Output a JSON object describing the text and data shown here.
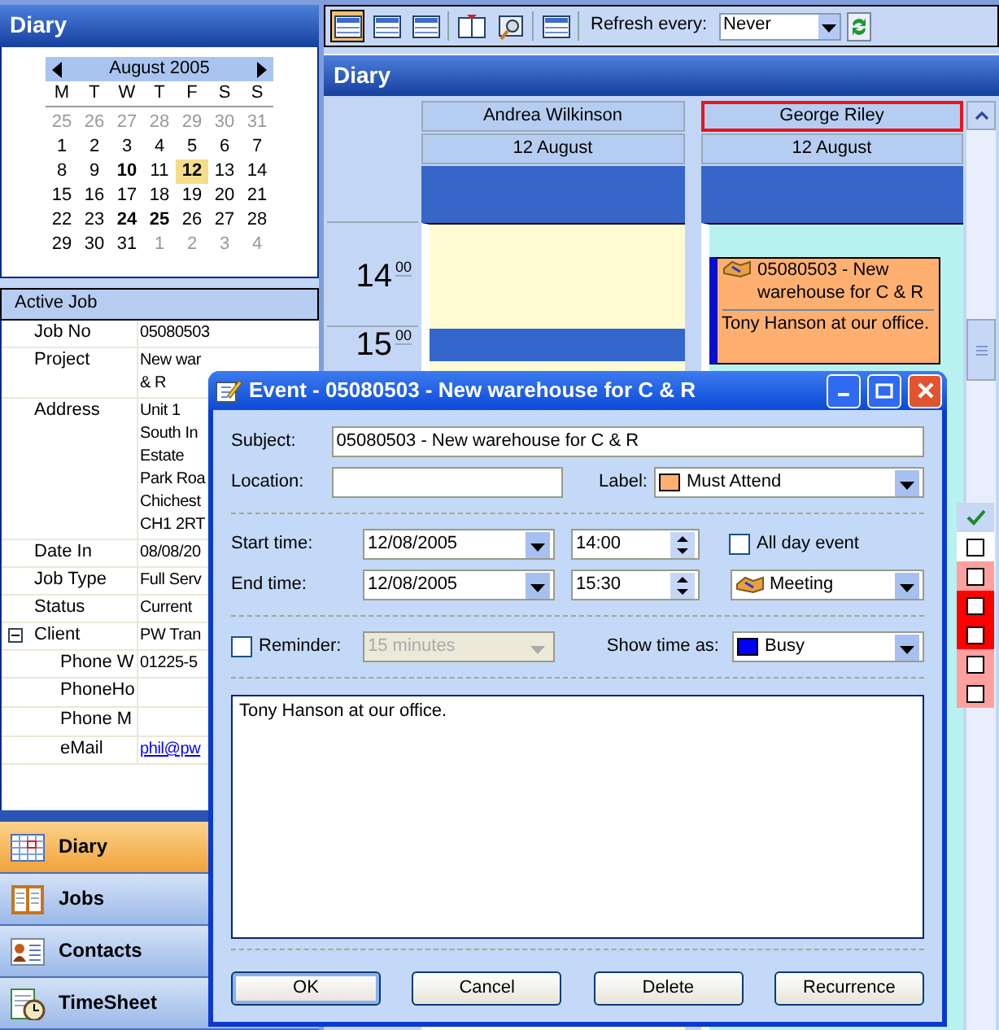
{
  "sidebar": {
    "title": "Diary",
    "calendar": {
      "month": "August 2005",
      "weekdays": [
        "M",
        "T",
        "W",
        "T",
        "F",
        "S",
        "S"
      ],
      "weeks": [
        [
          {
            "text": "25",
            "other_month": true,
            "bold": false,
            "selected": false
          },
          {
            "text": "26",
            "other_month": true,
            "bold": false,
            "selected": false
          },
          {
            "text": "27",
            "other_month": true,
            "bold": false,
            "selected": false
          },
          {
            "text": "28",
            "other_month": true,
            "bold": false,
            "selected": false
          },
          {
            "text": "29",
            "other_month": true,
            "bold": false,
            "selected": false
          },
          {
            "text": "30",
            "other_month": true,
            "bold": false,
            "selected": false
          },
          {
            "text": "31",
            "other_month": true,
            "bold": false,
            "selected": false
          }
        ],
        [
          {
            "text": "1",
            "other_month": false,
            "bold": false,
            "selected": false
          },
          {
            "text": "2",
            "other_month": false,
            "bold": false,
            "selected": false
          },
          {
            "text": "3",
            "other_month": false,
            "bold": false,
            "selected": false
          },
          {
            "text": "4",
            "other_month": false,
            "bold": false,
            "selected": false
          },
          {
            "text": "5",
            "other_month": false,
            "bold": false,
            "selected": false
          },
          {
            "text": "6",
            "other_month": false,
            "bold": false,
            "selected": false
          },
          {
            "text": "7",
            "other_month": false,
            "bold": false,
            "selected": false
          }
        ],
        [
          {
            "text": "8",
            "other_month": false,
            "bold": false,
            "selected": false
          },
          {
            "text": "9",
            "other_month": false,
            "bold": false,
            "selected": false
          },
          {
            "text": "10",
            "other_month": false,
            "bold": true,
            "selected": false
          },
          {
            "text": "11",
            "other_month": false,
            "bold": false,
            "selected": false
          },
          {
            "text": "12",
            "other_month": false,
            "bold": true,
            "selected": true
          },
          {
            "text": "13",
            "other_month": false,
            "bold": false,
            "selected": false
          },
          {
            "text": "14",
            "other_month": false,
            "bold": false,
            "selected": false
          }
        ],
        [
          {
            "text": "15",
            "other_month": false,
            "bold": false,
            "selected": false
          },
          {
            "text": "16",
            "other_month": false,
            "bold": false,
            "selected": false
          },
          {
            "text": "17",
            "other_month": false,
            "bold": false,
            "selected": false
          },
          {
            "text": "18",
            "other_month": false,
            "bold": false,
            "selected": false
          },
          {
            "text": "19",
            "other_month": false,
            "bold": false,
            "selected": false
          },
          {
            "text": "20",
            "other_month": false,
            "bold": false,
            "selected": false
          },
          {
            "text": "21",
            "other_month": false,
            "bold": false,
            "selected": false
          }
        ],
        [
          {
            "text": "22",
            "other_month": false,
            "bold": false,
            "selected": false
          },
          {
            "text": "23",
            "other_month": false,
            "bold": false,
            "selected": false
          },
          {
            "text": "24",
            "other_month": false,
            "bold": true,
            "selected": false
          },
          {
            "text": "25",
            "other_month": false,
            "bold": true,
            "selected": false
          },
          {
            "text": "26",
            "other_month": false,
            "bold": false,
            "selected": false
          },
          {
            "text": "27",
            "other_month": false,
            "bold": false,
            "selected": false
          },
          {
            "text": "28",
            "other_month": false,
            "bold": false,
            "selected": false
          }
        ],
        [
          {
            "text": "29",
            "other_month": false,
            "bold": false,
            "selected": false
          },
          {
            "text": "30",
            "other_month": false,
            "bold": false,
            "selected": false
          },
          {
            "text": "31",
            "other_month": false,
            "bold": false,
            "selected": false
          },
          {
            "text": "1",
            "other_month": true,
            "bold": false,
            "selected": false
          },
          {
            "text": "2",
            "other_month": true,
            "bold": false,
            "selected": false
          },
          {
            "text": "3",
            "other_month": true,
            "bold": false,
            "selected": false
          },
          {
            "text": "4",
            "other_month": true,
            "bold": false,
            "selected": false
          }
        ]
      ]
    },
    "active_job": {
      "title": "Active Job",
      "rows": [
        {
          "label": "Job No",
          "lines": [
            "05080503"
          ]
        },
        {
          "label": "Project",
          "lines": [
            "New war",
            "& R"
          ]
        },
        {
          "label": "Address",
          "lines": [
            "Unit 1",
            "South In",
            "Estate",
            "Park Roa",
            "Chichest",
            "CH1 2RT"
          ]
        },
        {
          "label": "Date In",
          "lines": [
            "08/08/20"
          ]
        },
        {
          "label": "Job Type",
          "lines": [
            "Full Serv"
          ]
        },
        {
          "label": "Status",
          "lines": [
            "Current"
          ]
        },
        {
          "label": "Client",
          "lines": [
            "PW Tran"
          ],
          "expanded": true,
          "children": [
            {
              "label": "Phone W",
              "lines": [
                "01225-5"
              ]
            },
            {
              "label": "PhoneHo"
            },
            {
              "label": "Phone M"
            },
            {
              "label": "eMail",
              "lines": [
                "phil@pw"
              ],
              "kind": "link"
            }
          ]
        }
      ]
    },
    "nav": [
      {
        "label": "Diary",
        "selected": true
      },
      {
        "label": "Jobs",
        "selected": false
      },
      {
        "label": "Contacts",
        "selected": false
      },
      {
        "label": "TimeSheet",
        "selected": false
      }
    ]
  },
  "toolbar": {
    "buttons": [
      {
        "selected": true
      },
      {
        "selected": false
      },
      {
        "selected": false
      },
      {
        "selected": false
      },
      {
        "selected": false
      },
      {
        "selected": false
      }
    ],
    "refresh_label": "Refresh every:",
    "refresh_value": "Never"
  },
  "diary": {
    "title": "Diary",
    "hours": [
      {
        "hour": "14",
        "minutes": "00"
      },
      {
        "hour": "15",
        "minutes": "00"
      }
    ],
    "resources": [
      {
        "name": "Andrea Wilkinson",
        "date": "12 August",
        "selected": false,
        "events": [
          {
            "color": "#3366cc"
          }
        ]
      },
      {
        "name": "George Riley",
        "date": "12 August",
        "selected": true,
        "events": [
          {
            "title": "05080503 - New warehouse for C & R",
            "note": "Tony Hanson at our office.",
            "color": "#ffb070"
          }
        ]
      }
    ],
    "task_rows": [
      {
        "checked": false,
        "color": "#ffffff"
      },
      {
        "checked": false,
        "color": "#ffa0a0"
      },
      {
        "checked": false,
        "color": "#ff0000"
      },
      {
        "checked": false,
        "color": "#ff0000"
      },
      {
        "checked": false,
        "color": "#ffa0a0"
      },
      {
        "checked": false,
        "color": "#ffa0a0"
      }
    ]
  },
  "dialog": {
    "title": "Event - 05080503 - New warehouse for C & R",
    "subject_label": "Subject:",
    "subject": "05080503 - New warehouse for C & R",
    "location_label": "Location:",
    "label_label": "Label:",
    "label_option": {
      "text": "Must Attend",
      "color": "#ffb070"
    },
    "start_label": "Start time:",
    "start_date": "12/08/2005",
    "start_time": "14:00",
    "all_day": {
      "label": "All day event",
      "checked": false
    },
    "end_label": "End time:",
    "end_date": "12/08/2005",
    "end_time": "15:30",
    "category": "Meeting",
    "reminder": {
      "label": "Reminder:",
      "checked": false,
      "value": "15 minutes",
      "disabled": true
    },
    "show_as_label": "Show time as:",
    "show_as": {
      "text": "Busy",
      "color": "#0000ff"
    },
    "notes": "Tony Hanson at our office.",
    "buttons": [
      {
        "label": "OK",
        "default": true
      },
      {
        "label": "Cancel",
        "default": false
      },
      {
        "label": "Delete",
        "default": false
      },
      {
        "label": "Recurrence",
        "default": false
      }
    ]
  }
}
